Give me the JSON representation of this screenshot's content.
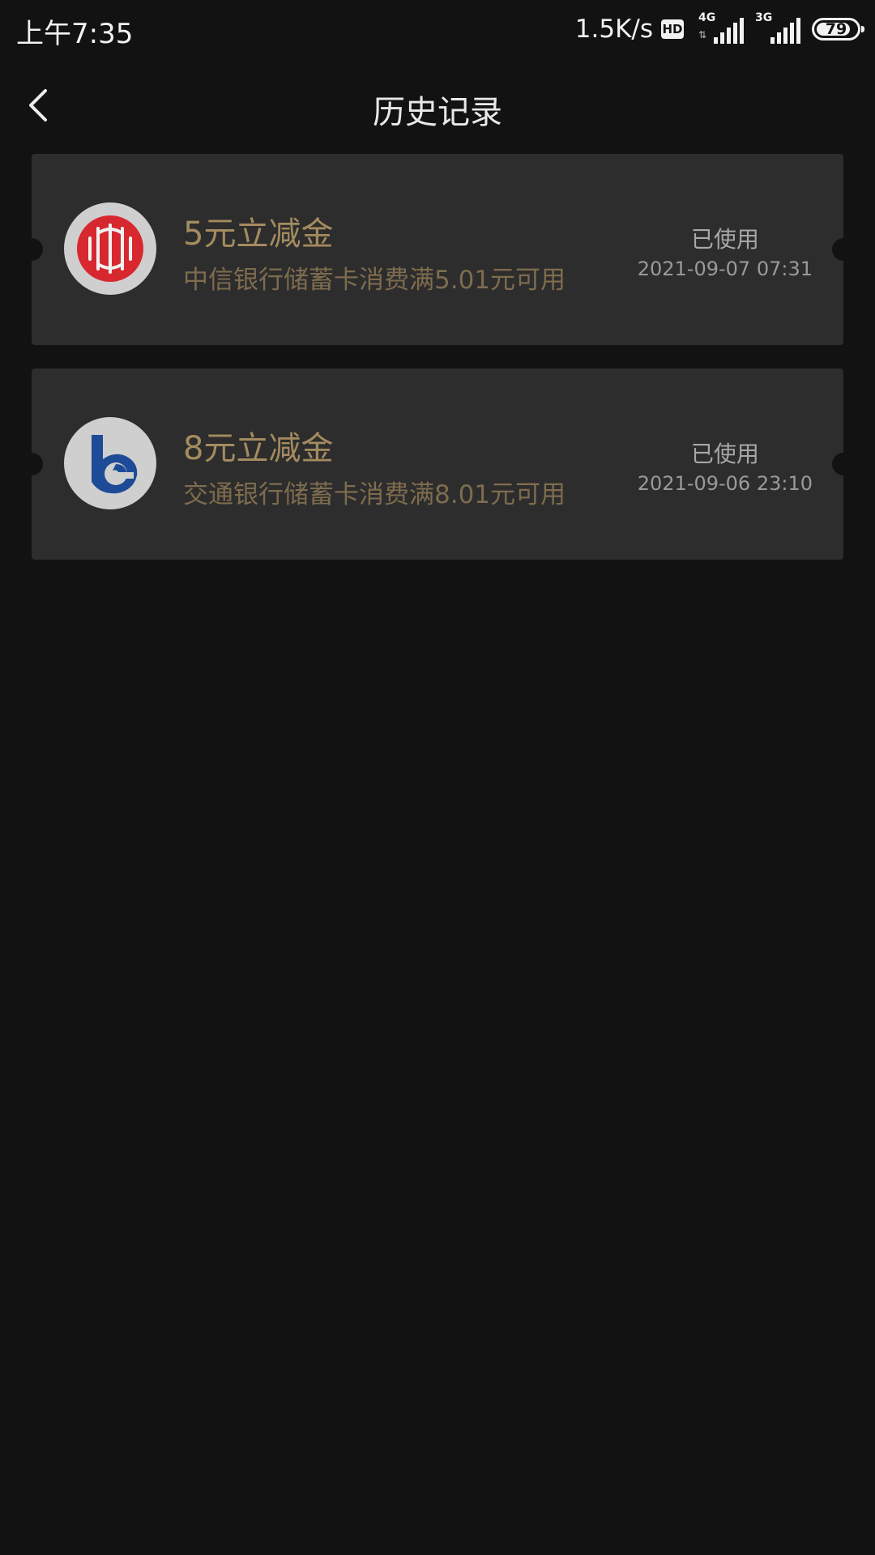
{
  "status_bar": {
    "time": "上午7:35",
    "net_speed": "1.5K/s",
    "hd": "HD",
    "signal_1": "4G",
    "signal_2": "3G",
    "battery": "79"
  },
  "header": {
    "back_icon": "chevron-left-icon",
    "title": "历史记录"
  },
  "coupons": [
    {
      "logo_icon": "citic-bank-logo-icon",
      "title": "5元立减金",
      "description": "中信银行储蓄卡消费满5.01元可用",
      "status": "已使用",
      "date": "2021-09-07 07:31"
    },
    {
      "logo_icon": "bank-of-communications-logo-icon",
      "title": "8元立减金",
      "description": "交通银行储蓄卡消费满8.01元可用",
      "status": "已使用",
      "date": "2021-09-06 23:10"
    }
  ],
  "colors": {
    "background": "#121212",
    "card": "#2d2d2d",
    "gold_title": "#a48b5f",
    "gold_desc": "#7e6c4e",
    "citic_red": "#d8282f",
    "bocom_blue": "#1e4b97"
  }
}
